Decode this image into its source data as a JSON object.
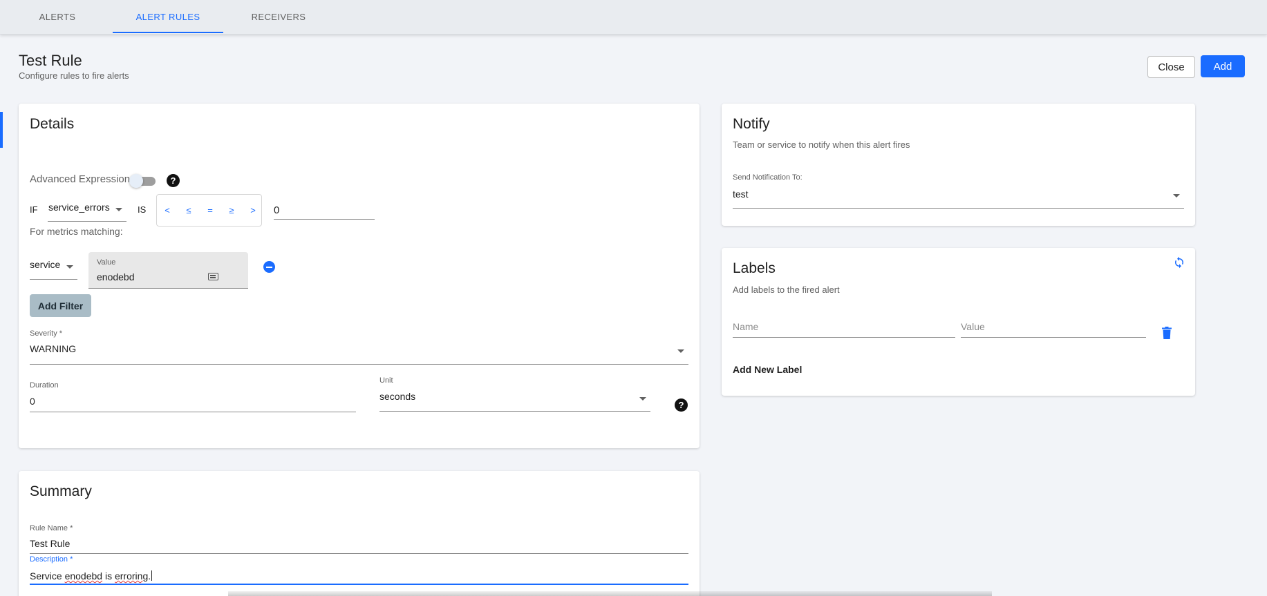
{
  "tabs": [
    {
      "label": "ALERTS",
      "active": false
    },
    {
      "label": "ALERT RULES",
      "active": true
    },
    {
      "label": "RECEIVERS",
      "active": false
    }
  ],
  "page": {
    "title": "Test Rule",
    "subtitle": "Configure rules to fire alerts"
  },
  "actions": {
    "close_label": "Close",
    "add_label": "Add"
  },
  "details": {
    "title": "Details",
    "advanced_label": "Advanced Expression",
    "advanced_enabled": false,
    "if_label": "IF",
    "metric_value": "service_errors",
    "is_label": "IS",
    "operators": [
      "<",
      "≤",
      "=",
      "≥",
      ">"
    ],
    "threshold_value": "0",
    "metrics_matching_label": "For metrics matching:",
    "filter_key": "service",
    "filter_value_label": "Value",
    "filter_value": "enodebd",
    "add_filter_label": "Add Filter",
    "severity_label": "Severity *",
    "severity_value": "WARNING",
    "duration_label": "Duration",
    "duration_value": "0",
    "unit_label": "Unit",
    "unit_value": "seconds"
  },
  "summary": {
    "title": "Summary",
    "rule_name_label": "Rule Name *",
    "rule_name_value": "Test Rule",
    "description_label": "Description *",
    "description_value_pre": "Service ",
    "description_value_misspelled": "enodebd",
    "description_value_mid": " is ",
    "description_value_misspelled2": "erroring",
    "description_value_post": "."
  },
  "notify": {
    "title": "Notify",
    "subtitle": "Team or service to notify when this alert fires",
    "send_to_label": "Send Notification To:",
    "send_to_value": "test"
  },
  "labels": {
    "title": "Labels",
    "subtitle": "Add labels to the fired alert",
    "name_placeholder": "Name",
    "value_placeholder": "Value",
    "add_new_label": "Add New Label"
  },
  "colors": {
    "accent": "#1a6cff",
    "background": "#f2f4f8",
    "add_filter_bg": "#a9bcc6"
  }
}
